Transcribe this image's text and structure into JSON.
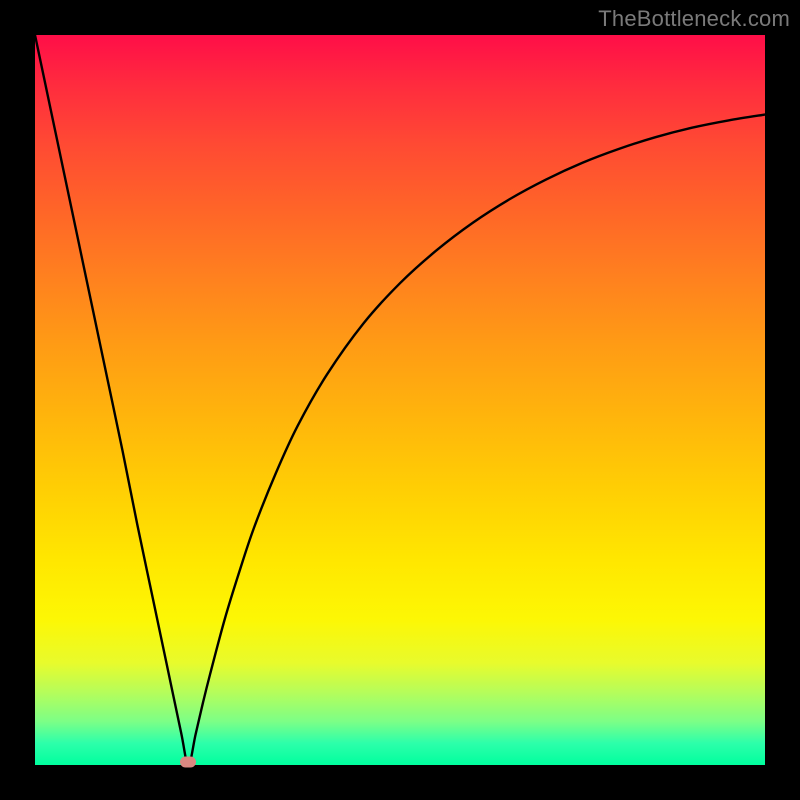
{
  "watermark": "TheBottleneck.com",
  "colors": {
    "frame": "#000000",
    "gradient_top": "#ff0e48",
    "gradient_bottom": "#00ff9e",
    "curve": "#000000",
    "marker": "#d98881",
    "watermark": "#7a7a7a"
  },
  "chart_data": {
    "type": "line",
    "title": "",
    "xlabel": "",
    "ylabel": "",
    "xlim": [
      0,
      100
    ],
    "ylim": [
      0,
      100
    ],
    "grid": false,
    "legend": false,
    "series": [
      {
        "name": "bottleneck-curve",
        "x": [
          0,
          2,
          4,
          6,
          8,
          10,
          12,
          14,
          16,
          18,
          20,
          21.0,
          22,
          23,
          24,
          26,
          28,
          30,
          33,
          36,
          40,
          45,
          50,
          55,
          60,
          65,
          70,
          75,
          80,
          85,
          90,
          95,
          100
        ],
        "values": [
          100,
          90.5,
          81,
          71.5,
          62,
          52.5,
          43,
          33,
          23.5,
          14,
          4.5,
          0.0,
          4.2,
          8.5,
          12.5,
          20,
          26.5,
          32.5,
          40,
          46.5,
          53.5,
          60.5,
          66.0,
          70.5,
          74.3,
          77.5,
          80.2,
          82.5,
          84.4,
          86.0,
          87.3,
          88.3,
          89.1
        ]
      }
    ],
    "annotations": [
      {
        "name": "optimum-marker",
        "x": 21.0,
        "y": 0.0
      }
    ]
  }
}
